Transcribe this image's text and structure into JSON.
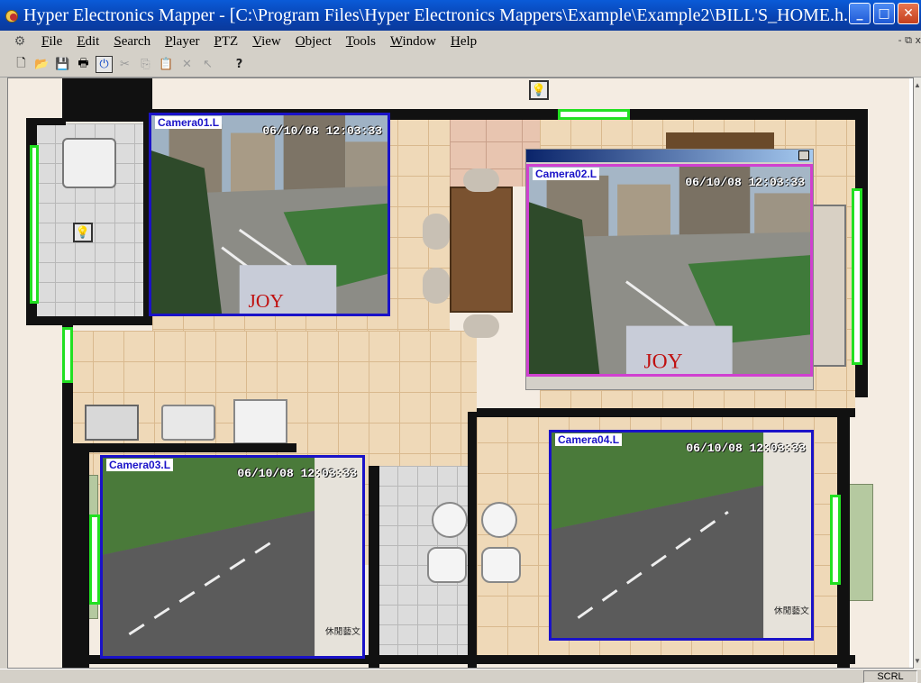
{
  "window": {
    "title": "Hyper Electronics Mapper - [C:\\Program Files\\Hyper Electronics Mappers\\Example\\Example2\\BILL'S_HOME.h...",
    "minimize_glyph": "_",
    "maximize_glyph": "□",
    "close_glyph": "✕"
  },
  "menu": {
    "items": [
      {
        "first": "F",
        "rest": "ile"
      },
      {
        "first": "E",
        "rest": "dit"
      },
      {
        "first": "S",
        "rest": "earch"
      },
      {
        "first": "P",
        "rest": "layer"
      },
      {
        "first": "P",
        "rest": "TZ"
      },
      {
        "first": "V",
        "rest": "iew"
      },
      {
        "first": "O",
        "rest": "bject"
      },
      {
        "first": "T",
        "rest": "ools"
      },
      {
        "first": "W",
        "rest": "indow"
      },
      {
        "first": "H",
        "rest": "elp"
      }
    ],
    "mdi_restore_glyph": "- ⧉ x"
  },
  "toolbar": {
    "new_icon": "new-document-icon",
    "open_icon": "open-folder-icon",
    "save_icon": "save-disk-icon",
    "print_icon": "printer-icon",
    "power_icon": "power-icon",
    "cut_icon": "scissors-icon",
    "copy_icon": "copy-icon",
    "paste_icon": "paste-icon",
    "delete_icon": "delete-x-icon",
    "pointer_icon": "pointer-arrow-icon",
    "help_icon": "help-question-icon",
    "help_glyph": "?"
  },
  "cameras": [
    {
      "label": "Camera01.L",
      "timestamp": "06/10/08 12:03:33"
    },
    {
      "label": "Camera02.L",
      "timestamp": "06/10/08 12:03:33"
    },
    {
      "label": "Camera03.L",
      "timestamp": "06/10/08 12:03:33"
    },
    {
      "label": "Camera04.L",
      "timestamp": "06/10/08 12:03:33"
    }
  ],
  "camera_scene_text": {
    "sign": "JOY",
    "banner_text": "休閒藝文"
  },
  "colors": {
    "camera_border": "#1a12c8",
    "sensor_border": "#22e022",
    "title_bar": "#0a5bd8"
  },
  "status": {
    "panel": "SCRL"
  }
}
